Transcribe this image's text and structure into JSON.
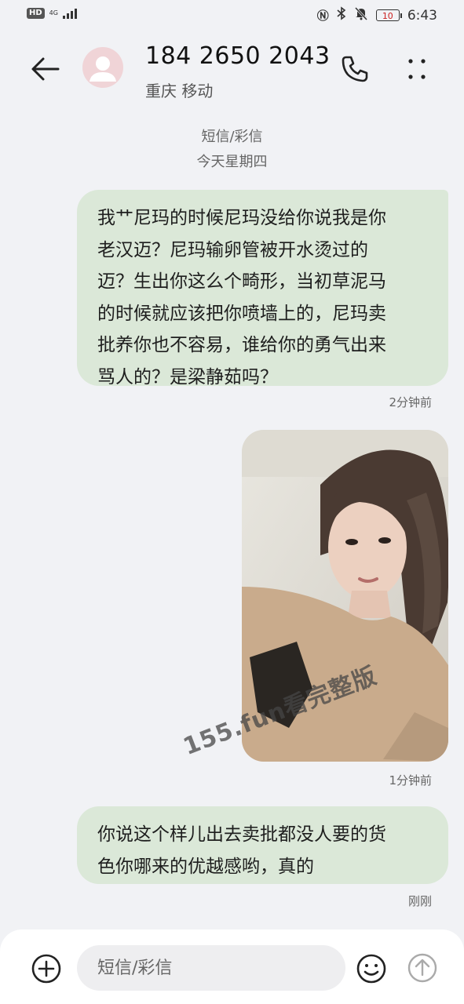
{
  "status_bar": {
    "hd": "HD",
    "network": "4G",
    "battery": "10",
    "time": "6:43"
  },
  "header": {
    "number": "184 2650 2043",
    "carrier": "重庆 移动"
  },
  "thread": {
    "type_label": "短信/彩信",
    "date_label": "今天星期四"
  },
  "messages": [
    {
      "text": "我艹尼玛的时候尼玛没给你说我是你\n老汉迈？尼玛输卵管被开水烫过的\n迈？生出你这么个畸形，当初草泥马\n的时候就应该把你喷墙上的，尼玛卖\n批养你也不容易，谁给你的勇气出来\n骂人的？是梁静茹吗？",
      "time": "2分钟前"
    },
    {
      "type": "image",
      "time": "1分钟前"
    },
    {
      "text": "你说这个样儿出去卖批都没人要的货\n色你哪来的优越感哟，真的",
      "time": "刚刚"
    }
  ],
  "watermark": "155.fun看完整版",
  "compose": {
    "placeholder": "短信/彩信"
  },
  "icons": [
    "back-arrow-icon",
    "avatar-icon",
    "phone-icon",
    "more-vertical-icon",
    "plus-circle-icon",
    "emoji-icon",
    "send-arrow-icon"
  ],
  "colors": {
    "background": "#f1f2f5",
    "bubble": "#dbe8d8",
    "avatar": "#f0d4d7"
  }
}
